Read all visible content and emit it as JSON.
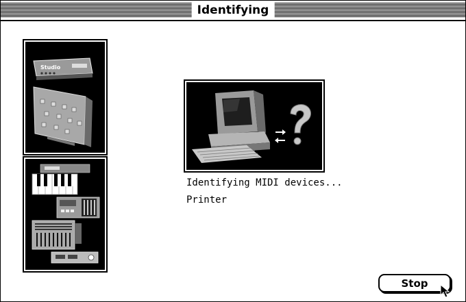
{
  "window": {
    "title": "Identifying"
  },
  "status": {
    "message": "Identifying MIDI devices...",
    "device": "Printer"
  },
  "buttons": {
    "stop_label": "Stop"
  },
  "images": {
    "studio_setup_label": "Studio",
    "midi_devices_label": "",
    "computer_query_label": ""
  }
}
